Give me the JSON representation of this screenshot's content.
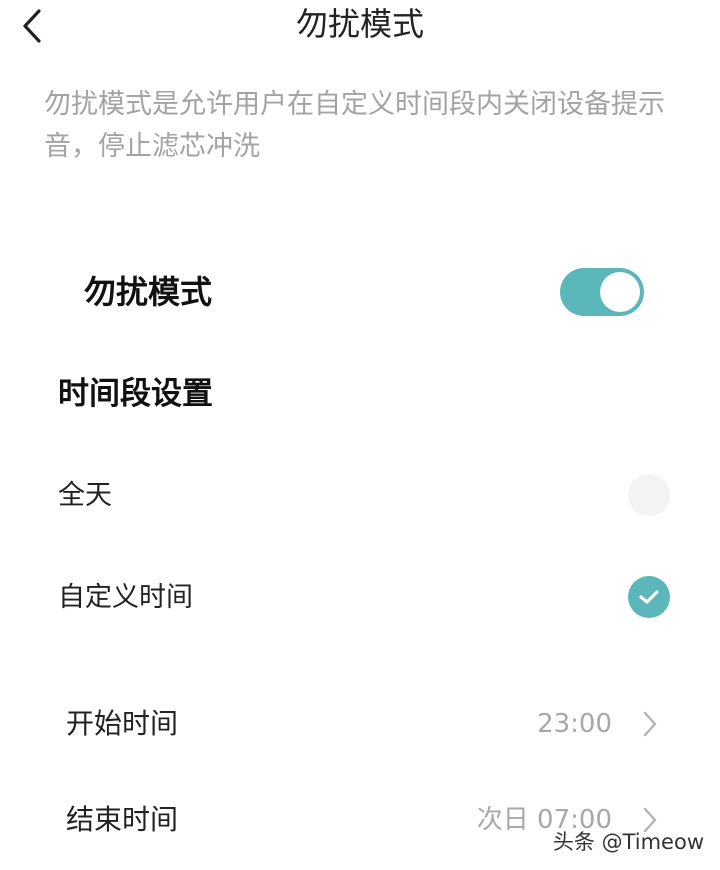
{
  "header": {
    "title": "勿扰模式",
    "back_icon": "chevron-left-icon"
  },
  "description": "勿扰模式是允许用户在自定义时间段内关闭设备提示音，停止滤芯冲洗",
  "dnd": {
    "label": "勿扰模式",
    "enabled": true
  },
  "schedule": {
    "heading": "时间段设置",
    "options": [
      {
        "label": "全天",
        "selected": false
      },
      {
        "label": "自定义时间",
        "selected": true
      }
    ],
    "start": {
      "label": "开始时间",
      "value": "23:00"
    },
    "end": {
      "label": "结束时间",
      "value": "次日 07:00"
    }
  },
  "watermark": "头条 @Timeow",
  "colors": {
    "accent": "#5bb7ba",
    "radio_off": "#f3f3f3",
    "secondary_text": "#a3a3a3"
  }
}
